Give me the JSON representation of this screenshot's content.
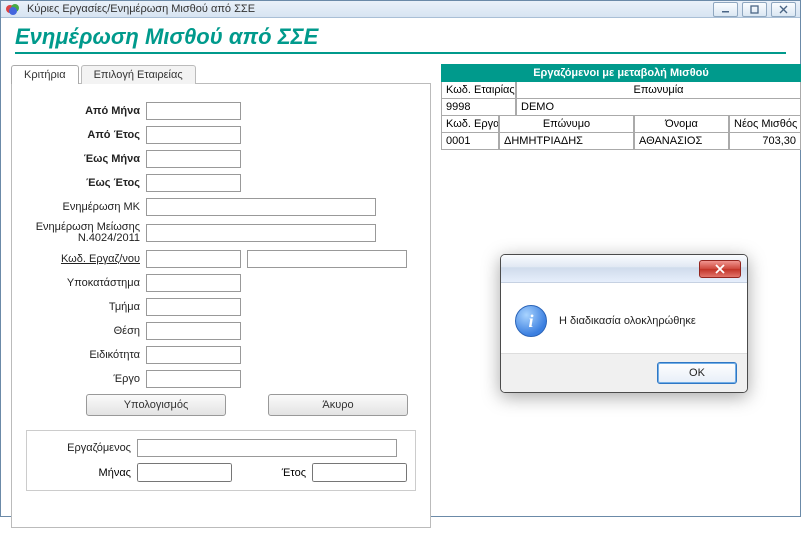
{
  "window": {
    "title": "Κύριες Εργασίες/Ενημέρωση Μισθού από ΣΣΕ"
  },
  "header": {
    "title": "Ενημέρωση Μισθού από ΣΣΕ"
  },
  "tabs": {
    "criteria": "Κριτήρια",
    "company": "Επιλογή Εταιρείας"
  },
  "fields": {
    "from_month": "Από Μήνα",
    "from_year": "Από Έτος",
    "to_month": "Έως Μήνα",
    "to_year": "Έως Έτος",
    "update_mk": "Ενημέρωση ΜΚ",
    "update_reduction": "Ενημέρωση Μείωσης Ν.4024/2011",
    "emp_code": "Κωδ. Εργαζ/νου",
    "branch": "Υποκατάστημα",
    "department": "Τμήμα",
    "position": "Θέση",
    "specialty": "Ειδικότητα",
    "project": "Έργο"
  },
  "buttons": {
    "calc": "Υπολογισμός",
    "cancel": "Άκυρο"
  },
  "summary": {
    "employee": "Εργαζόμενος",
    "month": "Μήνας",
    "year": "Έτος"
  },
  "grid": {
    "caption": "Εργαζόμενοι με μεταβολή Μισθού",
    "company_code_hdr": "Κωδ. Εταιρίας",
    "company_name_hdr": "Επωνυμία",
    "company_code": "9998",
    "company_name": "DEMO",
    "emp_code_hdr": "Κωδ. Εργαζ.",
    "surname_hdr": "Επώνυμο",
    "name_hdr": "Όνομα",
    "new_salary_hdr": "Νέος Μισθός",
    "emp_code": "0001",
    "surname": "ΔΗΜΗΤΡΙΑΔΗΣ",
    "name": "ΑΘΑΝΑΣΙΟΣ",
    "new_salary": "703,30"
  },
  "modal": {
    "message": "Η διαδικασία ολοκληρώθηκε",
    "ok": "OK"
  }
}
